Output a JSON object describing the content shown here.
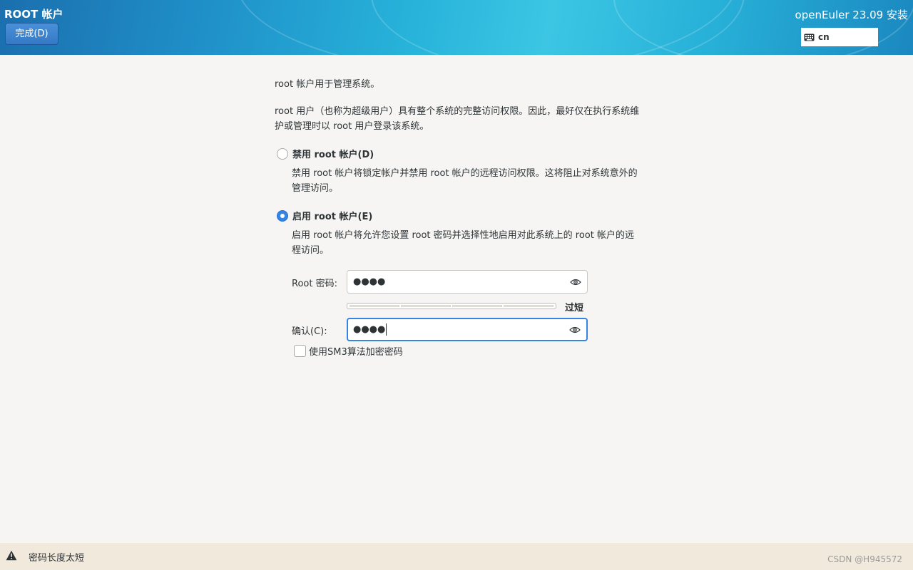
{
  "header": {
    "title": "ROOT 帐户",
    "done_label": "完成(D)",
    "product_title": "openEuler 23.09 安装",
    "keyboard_layout": "cn"
  },
  "intro": {
    "line1": "root 帐户用于管理系统。",
    "line2": "root 用户（也称为超级用户）具有整个系统的完整访问权限。因此，最好仅在执行系统维护或管理时以 root 用户登录该系统。"
  },
  "options": {
    "disable": {
      "label": "禁用 root 帐户(D)",
      "description": "禁用 root 帐户将锁定帐户并禁用 root 帐户的远程访问权限。这将阻止对系统意外的管理访问。",
      "selected": false
    },
    "enable": {
      "label": "启用 root 帐户(E)",
      "description": "启用 root 帐户将允许您设置 root 密码并选择性地启用对此系统上的 root 帐户的远程访问。",
      "selected": true
    }
  },
  "password": {
    "label": "Root 密码:",
    "value": "●●●●",
    "strength_label": "过短",
    "strength_level": 0
  },
  "confirm": {
    "label": "确认(C):",
    "value": "●●●●"
  },
  "sm3": {
    "label": "使用SM3算法加密密码",
    "checked": false
  },
  "status": {
    "message": "密码长度太短",
    "watermark": "CSDN @H945572"
  },
  "colors": {
    "accent": "#3584e4",
    "status_bar": "#f2e9dd"
  }
}
